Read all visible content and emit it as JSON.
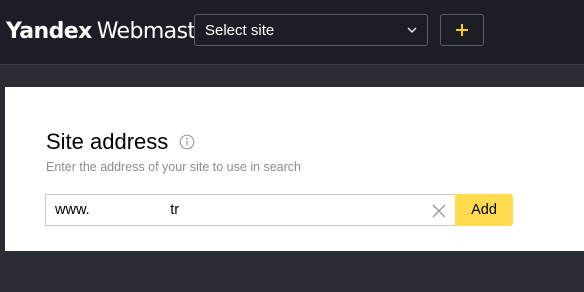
{
  "header": {
    "brand_logo": "Yandex",
    "brand_product": "Webmaster",
    "site_select_value": "Select site",
    "add_site_symbol": "+"
  },
  "form": {
    "title": "Site address",
    "subtitle": "Enter the address of your site to use in search",
    "address_value": "www.                    tr",
    "add_button_label": "Add"
  },
  "icons": {
    "site_select": "chevron-down-icon",
    "add_site": "plus-icon",
    "title_info": "info-icon",
    "address_clear": "close-icon"
  },
  "colors": {
    "header_bg": "#1b1e26",
    "page_bg": "#2a2d33",
    "accent_yellow": "#ffdb4d",
    "subtitle_gray": "#8c8c8c"
  }
}
